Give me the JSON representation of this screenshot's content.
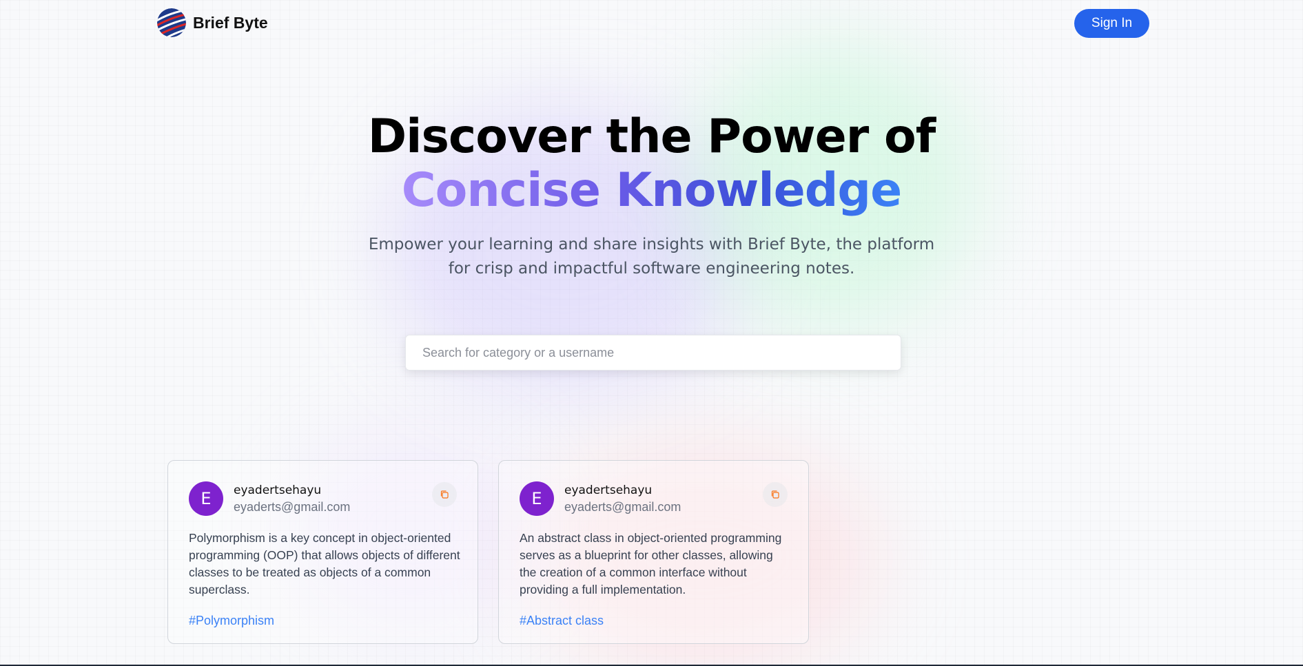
{
  "header": {
    "brand": "Brief Byte",
    "sign_in_label": "Sign In"
  },
  "hero": {
    "title_line1": "Discover the Power of",
    "title_line2": "Concise Knowledge",
    "subtitle": "Empower your learning and share insights with Brief Byte, the platform for crisp and impactful software engineering notes."
  },
  "search": {
    "placeholder": "Search for category or a username",
    "value": ""
  },
  "cards": [
    {
      "avatar_letter": "E",
      "username": "eyadertsehayu",
      "email": "eyaderts@gmail.com",
      "content": "Polymorphism is a key concept in object-oriented programming (OOP) that allows objects of different classes to be treated as objects of a common superclass.",
      "tag": "#Polymorphism",
      "copy_icon": "copy-icon"
    },
    {
      "avatar_letter": "E",
      "username": "eyadertsehayu",
      "email": "eyaderts@gmail.com",
      "content": "An abstract class in object-oriented programming serves as a blueprint for other classes, allowing the creation of a common interface without providing a full implementation.",
      "tag": "#Abstract class",
      "copy_icon": "copy-icon"
    }
  ],
  "colors": {
    "accent": "#2563eb",
    "avatar": "#7e22ce",
    "tag": "#3b82f6",
    "copy_icon": "#f97316"
  }
}
